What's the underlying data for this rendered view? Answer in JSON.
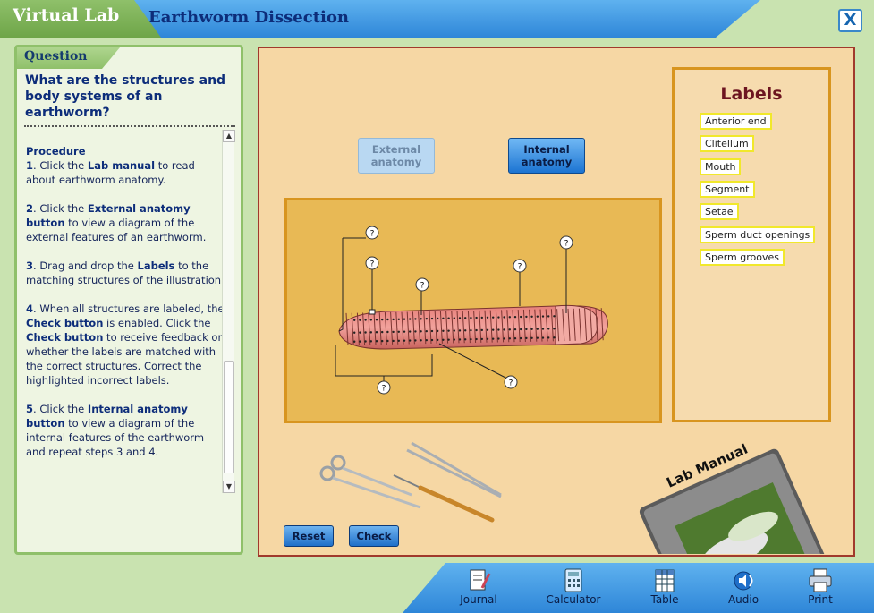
{
  "header": {
    "brand": "Virtual Lab",
    "title": "Earthworm Dissection",
    "close_label": "X"
  },
  "question": {
    "tab_label": "Question",
    "text": "What are the structures and body systems of an earthworm?"
  },
  "procedure": {
    "heading": "Procedure",
    "steps": [
      {
        "num": "1",
        "parts": [
          "Click the ",
          "Lab manual",
          " to read about earthworm anatomy."
        ]
      },
      {
        "num": "2",
        "parts": [
          "Click the ",
          "External anatomy button",
          " to view a diagram of the external features of an earthworm."
        ]
      },
      {
        "num": "3",
        "parts": [
          "Drag and drop the ",
          "Labels",
          " to the matching structures of the illustration."
        ]
      },
      {
        "num": "4",
        "parts": [
          "When all structures are labeled, the ",
          "Check button",
          " is enabled. Click the ",
          "Check button",
          " to receive feedback on whether the labels are matched with the correct structures. Correct the highlighted incorrect labels."
        ]
      },
      {
        "num": "5",
        "parts": [
          "Click the ",
          "Internal anatomy button",
          " to view a diagram of the internal features of the earthworm and repeat steps 3 and 4."
        ]
      }
    ]
  },
  "view_buttons": {
    "external": "External anatomy",
    "internal": "Internal anatomy"
  },
  "diagram": {
    "marker": "?",
    "marker_count": 8
  },
  "labels_panel": {
    "title": "Labels",
    "items": [
      "Anterior end",
      "Clitellum",
      "Mouth",
      "Segment",
      "Setae",
      "Sperm duct openings",
      "Sperm grooves"
    ]
  },
  "lab_manual": {
    "label": "Lab Manual"
  },
  "actions": {
    "reset": "Reset",
    "check": "Check"
  },
  "toolbar": {
    "items": [
      {
        "label": "Journal",
        "icon": "journal-icon"
      },
      {
        "label": "Calculator",
        "icon": "calculator-icon"
      },
      {
        "label": "Table",
        "icon": "table-icon"
      },
      {
        "label": "Audio",
        "icon": "audio-icon"
      },
      {
        "label": "Print",
        "icon": "print-icon"
      }
    ]
  },
  "colors": {
    "accent_blue": "#2e86d8",
    "brand_green": "#6ea548",
    "workspace_bg": "#f6d7a4",
    "label_highlight": "#f1e82b",
    "labels_title": "#6d1520"
  }
}
